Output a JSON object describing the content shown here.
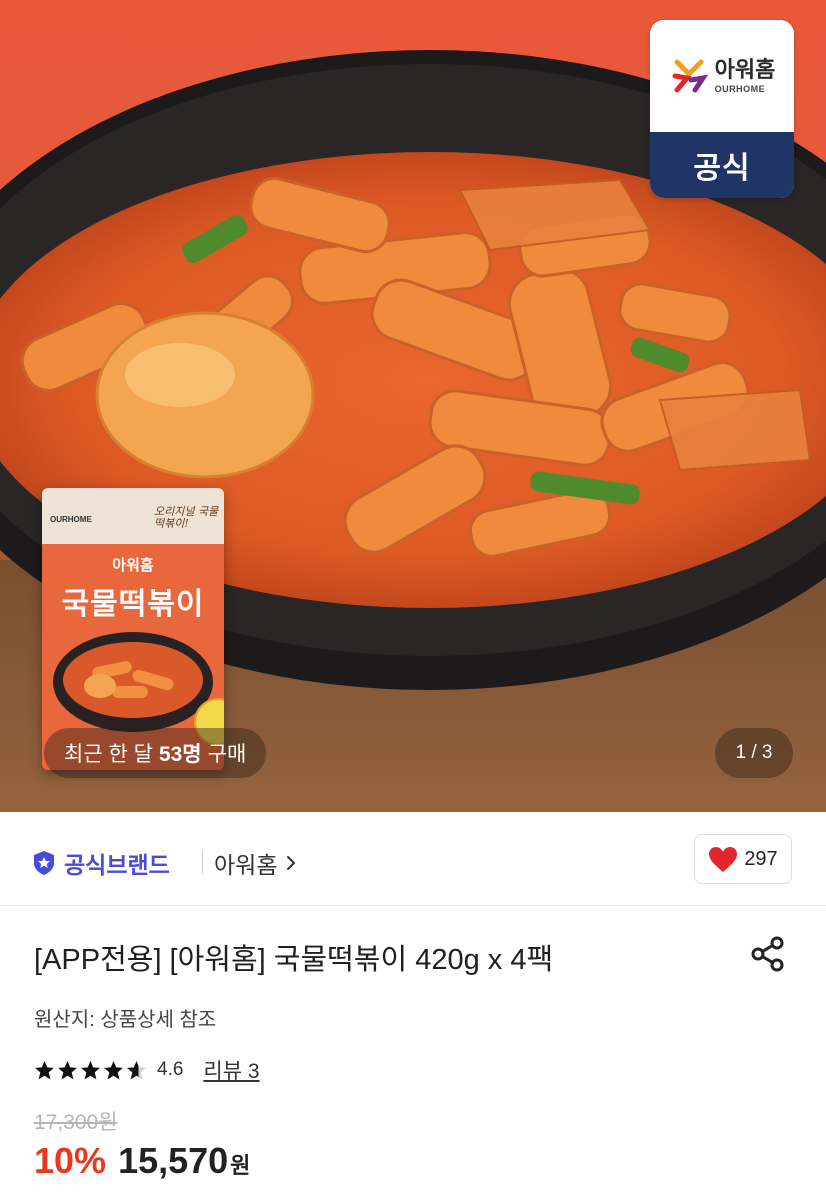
{
  "hero": {
    "brand_logo": {
      "brand_ko": "아워홈",
      "brand_en": "OURHOME",
      "official_label": "공식"
    },
    "package": {
      "brand": "OURHOME",
      "script_text": "오리지널 국물떡볶이!",
      "subtitle": "아워홈",
      "title": "국물떡볶이"
    },
    "recent_buy": {
      "prefix": "최근 한 달",
      "count": "53명",
      "suffix": "구매"
    },
    "page_indicator": "1 / 3"
  },
  "brand_bar": {
    "official_badge_label": "공식브랜드",
    "brand_name": "아워홈",
    "like_count": "297",
    "badge_color": "#4b4bd6",
    "heart_color": "#e2262c"
  },
  "product": {
    "title": "[APP전용] [아워홈] 국물떡볶이 420g x 4팩",
    "origin": "원산지: 상품상세 참조",
    "rating": 4.6,
    "rating_label": "4.6",
    "review_link": "리뷰 3",
    "original_price": "17,300원",
    "discount": "10%",
    "sale_price": "15,570",
    "currency": "원",
    "discount_color": "#e8391f"
  },
  "icons": {
    "share": "share-icon",
    "heart": "heart-icon",
    "star": "star-icon",
    "shield": "shield-star-icon",
    "chevron": "chevron-right-icon"
  }
}
